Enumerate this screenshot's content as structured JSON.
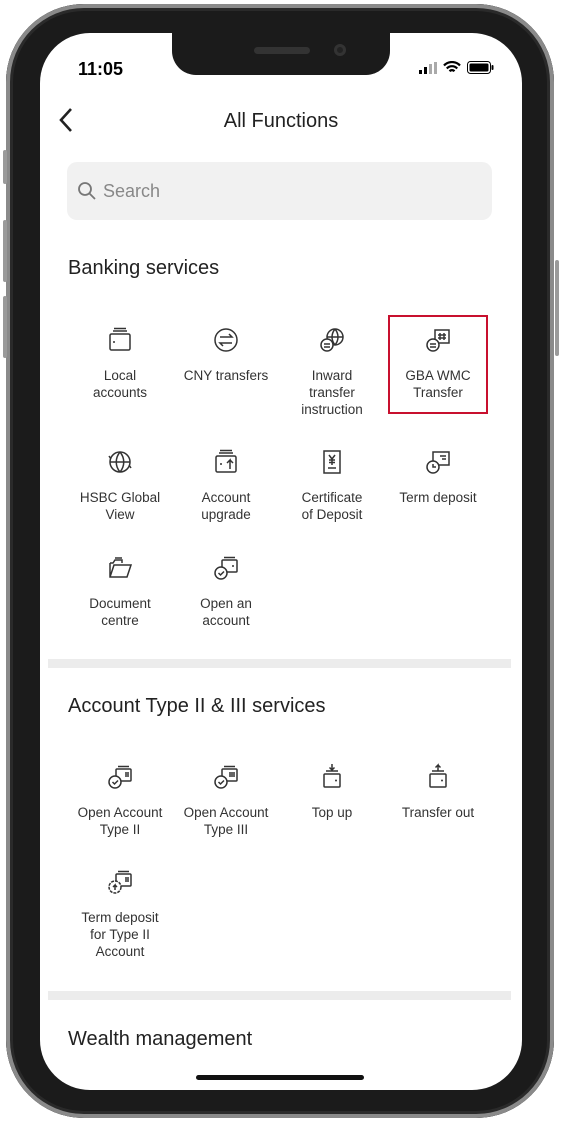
{
  "status_bar": {
    "time": "11:05",
    "icons": [
      "signal-icon",
      "wifi-icon",
      "battery-icon"
    ]
  },
  "header": {
    "title": "All Functions",
    "back_icon": "chevron-left-icon"
  },
  "search": {
    "placeholder": "Search",
    "icon": "search-icon"
  },
  "highlight_color": "#c8102e",
  "sections": [
    {
      "title": "Banking services",
      "items": [
        {
          "label": "Local\naccounts",
          "icon": "wallet-icon"
        },
        {
          "label": "CNY transfers",
          "icon": "transfer-arrows-icon"
        },
        {
          "label": "Inward\ntransfer\ninstruction",
          "icon": "globe-exchange-icon"
        },
        {
          "label": "GBA WMC\nTransfer",
          "icon": "gba-transfer-icon",
          "highlighted": true
        },
        {
          "label": "HSBC Global\nView",
          "icon": "globe-icon"
        },
        {
          "label": "Account\nupgrade",
          "icon": "wallet-upgrade-icon"
        },
        {
          "label": "Certificate\nof Deposit",
          "icon": "yuan-certificate-icon"
        },
        {
          "label": "Term deposit",
          "icon": "clock-card-icon"
        },
        {
          "label": "Document\ncentre",
          "icon": "folder-icon"
        },
        {
          "label": "Open an\naccount",
          "icon": "open-account-icon"
        }
      ]
    },
    {
      "title": "Account Type II & III services",
      "items": [
        {
          "label": "Open Account\nType II",
          "icon": "account-type-ii-icon"
        },
        {
          "label": "Open Account\nType III",
          "icon": "account-type-iii-icon"
        },
        {
          "label": "Top up",
          "icon": "top-up-icon"
        },
        {
          "label": "Transfer out",
          "icon": "transfer-out-icon"
        },
        {
          "label": "Term deposit\nfor Type II\nAccount",
          "icon": "term-deposit-type-ii-icon"
        }
      ]
    },
    {
      "title": "Wealth management",
      "items": []
    }
  ]
}
